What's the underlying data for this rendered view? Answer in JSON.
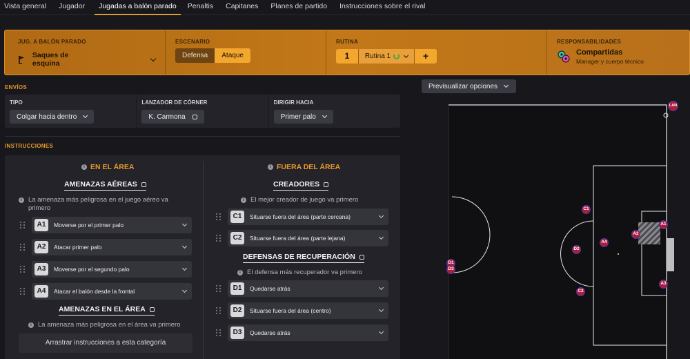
{
  "tabs": [
    "Vista general",
    "Jugador",
    "Jugadas a balón parado",
    "Penaltis",
    "Capitanes",
    "Planes de partido",
    "Instrucciones sobre el rival"
  ],
  "topbar": {
    "setplay_label": "JUG. A BALÓN PARADO",
    "setplay_value": "Saques de esquina",
    "scenario_label": "ESCENARIO",
    "scenario_options": [
      "Defensa",
      "Ataque"
    ],
    "routine_label": "RUTINA",
    "routine_number": "1",
    "routine_name": "Rutina 1",
    "routine_add": "+",
    "resp_label": "RESPONSABILIDADES",
    "resp_value": "Compartidas",
    "resp_sub": "Manager y cuerpo técnico"
  },
  "envios": {
    "title": "ENVÍOS",
    "tipo_label": "TIPO",
    "tipo_value": "Colgar hacia dentro",
    "lanzador_label": "LANZADOR DE CÓRNER",
    "lanzador_value": "K. Carmona",
    "dirigir_label": "DIRIGIR HACIA",
    "dirigir_value": "Primer palo"
  },
  "instrucciones": {
    "title": "INSTRUCCIONES",
    "left_head": "EN EL ÁREA",
    "right_head": "FUERA DEL ÁREA",
    "aereas": {
      "title": "AMENAZAS AÉREAS",
      "hint": "La amenaza más peligrosa en el juego aéreo va primero",
      "rows": [
        {
          "code": "A1",
          "text": "Moverse por el primer palo"
        },
        {
          "code": "A2",
          "text": "Atacar primer palo"
        },
        {
          "code": "A3",
          "text": "Moverse por el segundo palo"
        },
        {
          "code": "A4",
          "text": "Atacar el balón desde la frontal"
        }
      ]
    },
    "area": {
      "title": "AMENAZAS EN EL ÁREA",
      "hint": "La amenaza más peligrosa en el área va primero",
      "dropzone": "Arrastrar instrucciones a esta categoría"
    },
    "creadores": {
      "title": "CREADORES",
      "hint": "El mejor creador de juego va primero",
      "rows": [
        {
          "code": "C1",
          "text": "Situarse fuera del área (parte cercana)"
        },
        {
          "code": "C2",
          "text": "Situarse fuera del área (parte lejana)"
        }
      ]
    },
    "defensas": {
      "title": "DEFENSAS DE RECUPERACIÓN",
      "hint": "El defensa más recuperador va primero",
      "rows": [
        {
          "code": "D1",
          "text": "Quedarse atrás"
        },
        {
          "code": "D2",
          "text": "Situarse fuera del área (centro)"
        },
        {
          "code": "D3",
          "text": "Quedarse atrás"
        }
      ]
    }
  },
  "preview_label": "Previsualizar opciones",
  "pitch": {
    "players": [
      "LAN",
      "C1",
      "A1",
      "A2",
      "A4",
      "D2",
      "D1",
      "D3",
      "A3",
      "C2"
    ],
    "colors": {
      "player_fill": "#b21d35",
      "player_ring": "#3b3bb8",
      "accent": "#e59a2a"
    }
  }
}
